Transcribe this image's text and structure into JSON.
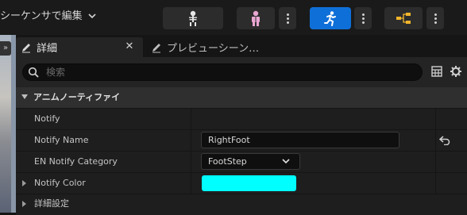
{
  "toolbar": {
    "sequence_label": "シーケンサで編集",
    "colors": {
      "active": "#0f6fd8",
      "button": "#2c2c2c"
    },
    "buttons": [
      {
        "icon": "skeleton-icon",
        "active": false
      },
      {
        "icon": "skeletal-mesh-icon",
        "active": false
      },
      {
        "icon": "running-figure-icon",
        "active": true
      },
      {
        "icon": "blueprint-graph-icon",
        "active": false
      }
    ]
  },
  "tabs": {
    "details": "詳細",
    "preview": "プレビューシーン…"
  },
  "search": {
    "placeholder": "検索"
  },
  "category": {
    "label": "アニムノーティファイ"
  },
  "rows": {
    "notify": {
      "label": "Notify"
    },
    "notify_name": {
      "label": "Notify Name",
      "value": "RightFoot"
    },
    "notify_category": {
      "label": "EN Notify Category",
      "value": "FootStep"
    },
    "notify_color": {
      "label": "Notify Color",
      "color": "#00ffff"
    },
    "advanced": {
      "label": "詳細設定"
    }
  }
}
